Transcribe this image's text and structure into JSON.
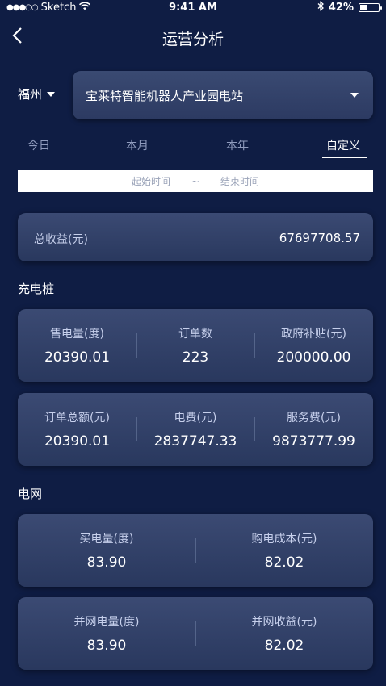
{
  "status_bar": {
    "carrier": "Sketch",
    "time": "9:41 AM",
    "battery": "42%",
    "battery_level": 0.42
  },
  "nav": {
    "title": "运营分析"
  },
  "filter": {
    "city": "福州",
    "station": "宝莱特智能机器人产业园电站"
  },
  "tabs": [
    "今日",
    "本月",
    "本年",
    "自定义"
  ],
  "active_tab": "自定义",
  "time_range": {
    "start": "起始时间",
    "separator": "~",
    "end": "结束时间"
  },
  "total": {
    "label": "总收益(元)",
    "value": "67697708.57"
  },
  "charging": {
    "title": "充电桩",
    "row1": [
      {
        "label": "售电量(度)",
        "value": "20390.01"
      },
      {
        "label": "订单数",
        "value": "223"
      },
      {
        "label": "政府补贴(元)",
        "value": "200000.00"
      }
    ],
    "row2": [
      {
        "label": "订单总额(元)",
        "value": "20390.01"
      },
      {
        "label": "电费(元)",
        "value": "2837747.33"
      },
      {
        "label": "服务费(元)",
        "value": "9873777.99"
      }
    ]
  },
  "grid": {
    "title": "电网",
    "row1": [
      {
        "label": "买电量(度)",
        "value": "83.90"
      },
      {
        "label": "购电成本(元)",
        "value": "82.02"
      }
    ],
    "row2": [
      {
        "label": "并网电量(度)",
        "value": "83.90"
      },
      {
        "label": "并网收益(元)",
        "value": "82.02"
      }
    ]
  }
}
